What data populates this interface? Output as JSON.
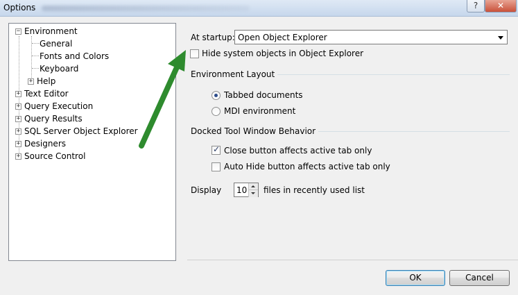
{
  "window": {
    "title": "Options",
    "help_glyph": "?",
    "close_glyph": "✕"
  },
  "tree": {
    "items": [
      {
        "label": "Environment",
        "expander": "−"
      },
      {
        "label": "General"
      },
      {
        "label": "Fonts and Colors"
      },
      {
        "label": "Keyboard"
      },
      {
        "label": "Help",
        "expander": "+"
      },
      {
        "label": "Text Editor",
        "expander": "+"
      },
      {
        "label": "Query Execution",
        "expander": "+"
      },
      {
        "label": "Query Results",
        "expander": "+"
      },
      {
        "label": "SQL Server Object Explorer",
        "expander": "+"
      },
      {
        "label": "Designers",
        "expander": "+"
      },
      {
        "label": "Source Control",
        "expander": "+"
      }
    ]
  },
  "startup": {
    "label": "At startup:",
    "value": "Open Object Explorer"
  },
  "hide_system_objects": {
    "label": "Hide system objects in Object Explorer",
    "checked": false
  },
  "environment_layout": {
    "title": "Environment Layout",
    "options": [
      {
        "label": "Tabbed documents",
        "selected": true
      },
      {
        "label": "MDI environment",
        "selected": false
      }
    ]
  },
  "docked_behavior": {
    "title": "Docked Tool Window Behavior",
    "options": [
      {
        "label": "Close button affects active tab only",
        "checked": true,
        "check_glyph": "✓"
      },
      {
        "label": "Auto Hide button affects active tab only",
        "checked": false
      }
    ]
  },
  "recent_files": {
    "prefix": "Display",
    "value": "10",
    "suffix": "files in recently used list"
  },
  "buttons": {
    "ok": "OK",
    "cancel": "Cancel"
  },
  "colors": {
    "annotation_arrow": "#2e8b2e"
  }
}
